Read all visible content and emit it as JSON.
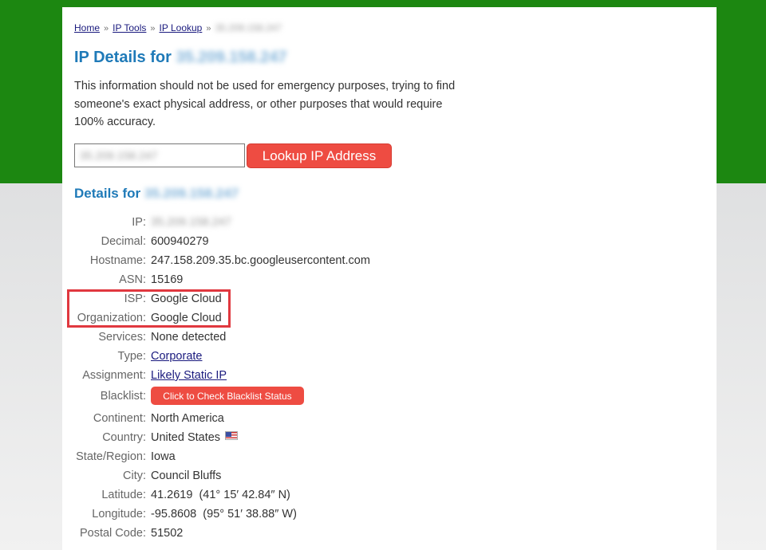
{
  "breadcrumb": {
    "home": "Home",
    "ip_tools": "IP Tools",
    "ip_lookup": "IP Lookup",
    "separator": "»",
    "current_blurred": "35.209.158.247"
  },
  "title": {
    "prefix": "IP Details for",
    "ip_blurred": "35.209.158.247"
  },
  "disclaimer": "This information should not be used for emergency purposes, trying to find someone's exact physical address, or other purposes that would require 100% accuracy.",
  "lookup": {
    "input_value_blurred": "35.209.158.247",
    "button_label": "Lookup IP Address"
  },
  "subtitle": {
    "prefix": "Details for",
    "ip_blurred": "35.209.158.247"
  },
  "details": {
    "ip": {
      "label": "IP:",
      "value_blurred": "35.209.158.247"
    },
    "decimal": {
      "label": "Decimal:",
      "value": "600940279"
    },
    "hostname": {
      "label": "Hostname:",
      "value": "247.158.209.35.bc.googleusercontent.com"
    },
    "asn": {
      "label": "ASN:",
      "value": "15169"
    },
    "isp": {
      "label": "ISP:",
      "value": "Google Cloud"
    },
    "organization": {
      "label": "Organization:",
      "value": "Google Cloud"
    },
    "services": {
      "label": "Services:",
      "value": "None detected"
    },
    "type": {
      "label": "Type:",
      "value": "Corporate"
    },
    "assignment": {
      "label": "Assignment:",
      "value": "Likely Static IP"
    },
    "blacklist": {
      "label": "Blacklist:",
      "button_label": "Click to Check Blacklist Status"
    },
    "continent": {
      "label": "Continent:",
      "value": "North America"
    },
    "country": {
      "label": "Country:",
      "value": "United States",
      "flag_icon": "us-flag-icon"
    },
    "region": {
      "label": "State/Region:",
      "value": "Iowa"
    },
    "city": {
      "label": "City:",
      "value": "Council Bluffs"
    },
    "latitude": {
      "label": "Latitude:",
      "value": "41.2619  (41° 15′ 42.84″ N)"
    },
    "longitude": {
      "label": "Longitude:",
      "value": "-95.8608  (95° 51′ 38.88″ W)"
    },
    "postal": {
      "label": "Postal Code:",
      "value": "51502"
    }
  },
  "colors": {
    "header_green": "#1c8711",
    "title_blue": "#1f7ab8",
    "button_red": "#ee4c42",
    "highlight_red": "#e0383f"
  }
}
